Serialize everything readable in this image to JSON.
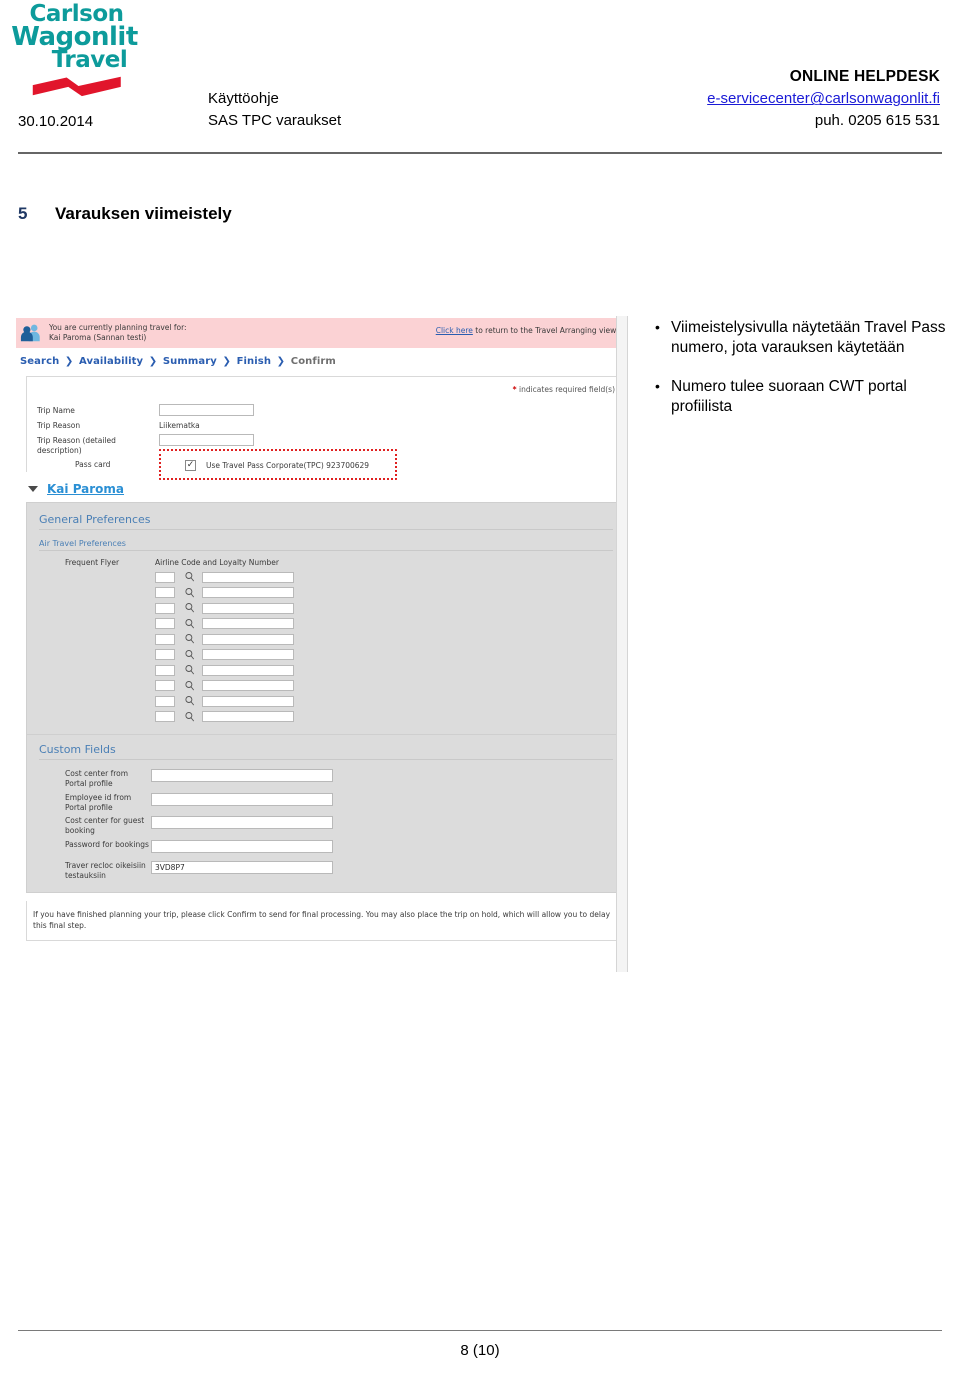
{
  "header": {
    "logo": {
      "line1": "Carlson",
      "line2": "Wagonlit",
      "line3": "Travel",
      "text_color": "#0d9b9b",
      "ribbon_color": "#e1152b"
    },
    "date": "30.10.2014",
    "doc_type": "Käyttöohje",
    "doc_subject": "SAS TPC varaukset",
    "helpdesk_title": "ONLINE HELPDESK",
    "helpdesk_email": "e-servicecenter@carlsonwagonlit.fi",
    "helpdesk_phone": "puh. 0205 615 531",
    "email_link_color": "#1a1ad6"
  },
  "section": {
    "number": "5",
    "title": "Varauksen viimeistely",
    "number_color": "#1f3864"
  },
  "screenshot": {
    "traveler_banner": {
      "icon": "people-icon",
      "line1": "You are currently planning travel for:",
      "line2": "Kai Paroma  (Sannan testi)",
      "link_text": "Click  here",
      "link_suffix": " to return to the Travel Arranging view.",
      "background": "#fbd2d4"
    },
    "breadcrumbs": {
      "items": [
        "Search",
        "Availability",
        "Summary",
        "Finish",
        "Confirm"
      ],
      "separator": "❯",
      "current": "Confirm",
      "link_color": "#2a5db0",
      "current_color": "#6f6f6f"
    },
    "required_note": {
      "asterisk": "*",
      "text": "indicates required field(s)"
    },
    "trip_form": {
      "rows": [
        {
          "label": "Trip Name",
          "type": "input",
          "value": ""
        },
        {
          "label": "Trip Reason",
          "type": "static",
          "value": "Liikematka"
        },
        {
          "label": "Trip Reason (detailed description)",
          "type": "input",
          "value": ""
        }
      ],
      "pass_card": {
        "label": "Pass card",
        "checkbox_checked": true,
        "checkmark": "✓",
        "option_text": "Use Travel Pass Corporate(TPC)  923700629",
        "tpc_number": "923700629",
        "highlight_color": "#e02020"
      }
    },
    "traveler_link": {
      "label": "Kai Paroma",
      "color": "#2a8fd4",
      "toggle_icon": "chevron-down-icon"
    },
    "preferences": {
      "group_title": "General Preferences",
      "sub_title": "Air Travel Preferences",
      "frequent_flyer_label": "Frequent Flyer",
      "column_header": "Airline Code and Loyalty Number",
      "row_count": 10,
      "rows": [
        {
          "code": "",
          "number": ""
        },
        {
          "code": "",
          "number": ""
        },
        {
          "code": "",
          "number": ""
        },
        {
          "code": "",
          "number": ""
        },
        {
          "code": "",
          "number": ""
        },
        {
          "code": "",
          "number": ""
        },
        {
          "code": "",
          "number": ""
        },
        {
          "code": "",
          "number": ""
        },
        {
          "code": "",
          "number": ""
        },
        {
          "code": "",
          "number": ""
        }
      ],
      "title_color": "#4a7fb5"
    },
    "custom_fields": {
      "title": "Custom Fields",
      "fields": [
        {
          "label": "Cost center from Portal profile",
          "value": ""
        },
        {
          "label": "Employee id from Portal profile",
          "value": ""
        },
        {
          "label": "Cost center for guest booking",
          "value": ""
        },
        {
          "label": "Password for bookings",
          "value": ""
        },
        {
          "label": "Traver recloc oikeisiin testauksiin",
          "value": "3VD8P7"
        }
      ]
    },
    "footer_note": "If you have finished planning your trip, please click Confirm to send for final processing. You may also place the trip on hold, which will allow you to delay this final step."
  },
  "bullets": [
    "Viimeistelysivulla näytetään Travel Pass numero, jota varauksen käytetään",
    "Numero tulee suoraan CWT portal profiilista"
  ],
  "footer": {
    "page": "8 (10)"
  }
}
